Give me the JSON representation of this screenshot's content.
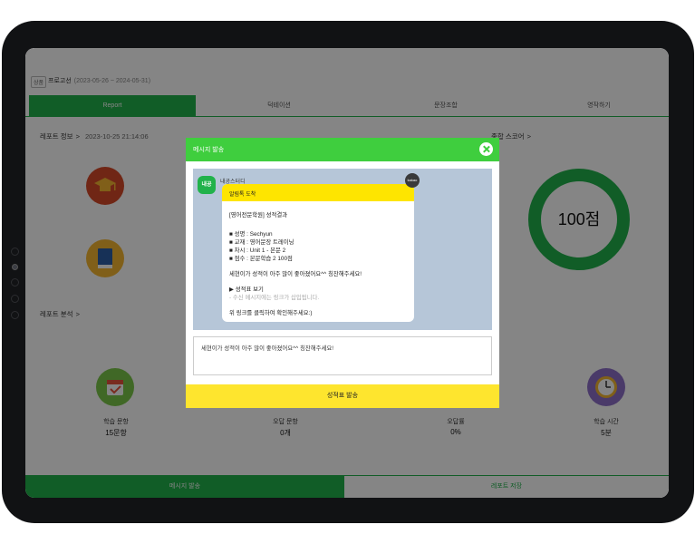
{
  "header": {
    "tag": "상품",
    "project_name": "프로고선",
    "project_dates": "(2023-05-26 ~ 2024-05-31)"
  },
  "tabs": [
    {
      "label": "Report",
      "active": true
    },
    {
      "label": "덕테이션",
      "active": false
    },
    {
      "label": "문장조합",
      "active": false
    },
    {
      "label": "영작하기",
      "active": false
    }
  ],
  "report_info": {
    "title": "레포트 정보",
    "arrow": ">",
    "timestamp": "2023-10-25 21:14:06"
  },
  "total_score": {
    "title": "종합 스코어",
    "arrow": ">",
    "value": "100점",
    "fraction": 1.0
  },
  "report_analysis": {
    "title": "레포트 분석",
    "arrow": ">"
  },
  "stats": [
    {
      "label": "학습 문항",
      "value": "15문항"
    },
    {
      "label": "오답 문항",
      "value": "0개"
    },
    {
      "label": "오답률",
      "value": "0%"
    },
    {
      "label": "학습 시간",
      "value": "5분"
    }
  ],
  "bottom_bar": {
    "send_label": "메시지 발송",
    "save_label": "레포트 저장"
  },
  "modal": {
    "title": "메시지 발송",
    "preview": {
      "avatar_text": "내공",
      "sender": "내공스터디",
      "badge": "kakao",
      "bubble_title": "알림톡 도착",
      "lines": [
        "[영어전문학원] 성적결과",
        "",
        "■ 성명 : Sechyun",
        "■ 교재 : 영어문장 트레이닝",
        "■ 차시 : Unit 1 - 본문 2",
        "■ 점수 : 본문학습 2 100점",
        "",
        "세현이가 성적이 아주 많이 좋아졌어요^^ 칭찬해주세요!",
        "",
        "▶ 성적표 보기",
        "- 수신 메시지에는 링크가 삽입됩니다.",
        "",
        "위 링크를 클릭하여 확인해주세요:)"
      ]
    },
    "message_value": "세현이가 성적이 아주 많이 좋아졌어요^^ 칭찬해주세요!",
    "send_button": "성적표 발송"
  },
  "colors": {
    "accent": "#21b24b",
    "modal_header": "#3fce3e",
    "kakao_yellow": "#fee500"
  },
  "icons": [
    "graduation-cap-icon",
    "book-icon",
    "calendar-check-icon",
    "clock-icon"
  ]
}
